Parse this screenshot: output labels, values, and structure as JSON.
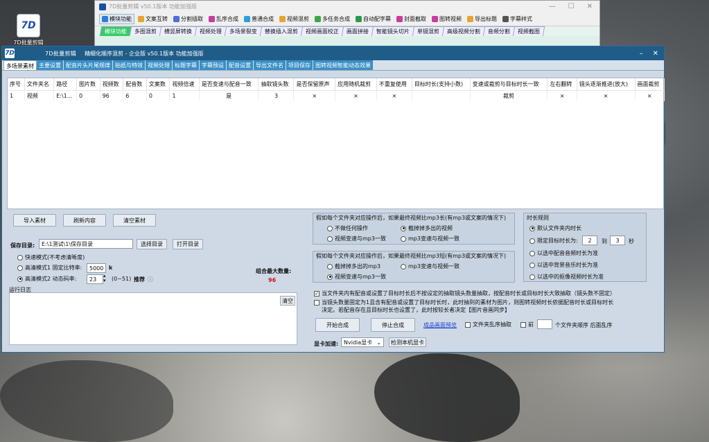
{
  "desktop": {
    "icon_label": "7D批量剪辑"
  },
  "back_window": {
    "title": "7D批量剪辑 v50.1版本 功能加强版",
    "toolbar": [
      {
        "label": "模块功能",
        "color": "#2a7ed8",
        "active": true
      },
      {
        "label": "文案互转",
        "color": "#e7a431"
      },
      {
        "label": "分割插取",
        "color": "#4a6fd8"
      },
      {
        "label": "乱序合成",
        "color": "#c83ca0"
      },
      {
        "label": "普通合成",
        "color": "#2aa0d8"
      },
      {
        "label": "视频混剪",
        "color": "#e7a431"
      },
      {
        "label": "多任务合成",
        "color": "#3aa84a"
      },
      {
        "label": "自动配字幕",
        "color": "#2a9a4a"
      },
      {
        "label": "封面截取",
        "color": "#c83ca0"
      },
      {
        "label": "图转视频",
        "color": "#c83ca0"
      },
      {
        "label": "导出标题",
        "color": "#e7a431"
      },
      {
        "label": "字幕样式",
        "color": "#555555"
      }
    ],
    "subtabs": [
      "模块功能",
      "多图混剪",
      "横竖屏转换",
      "视频处理",
      "多场景裂变",
      "替换插入混剪",
      "视频画面校正",
      "画面拼接",
      "智能镜头切片",
      "单镜混剪",
      "高级视频分割",
      "音频分割",
      "视频截图"
    ]
  },
  "main_window": {
    "title": "7D批量剪辑",
    "subtitle": "精细化顺序混剪 - 企业版  v50.1版本  功能加强版",
    "tabs": [
      "多场景素材",
      "主要设置",
      "配音片头片尾规律",
      "贴纸与特效",
      "视频处理",
      "标题字幕",
      "字幕预设",
      "配音设置",
      "导出文件名",
      "项目保存",
      "图转视频智能动态效果"
    ],
    "table": {
      "headers": [
        "序号",
        "文件夹名",
        "路径",
        "图片数",
        "视频数",
        "配音数",
        "文案数",
        "视频倍速",
        "是否变速与配音一致",
        "抽取镜头数",
        "是否保留原声",
        "应用随机裁剪",
        "不重复使用",
        "目标时长(支持小数)",
        "变速或裁剪与目标时长一致",
        "左右翻转",
        "镜头逐渐推进(放大)",
        "画面裁剪"
      ],
      "rows": [
        [
          "1",
          "视频",
          "E:\\1...",
          "0",
          "96",
          "6",
          "0",
          "1",
          "是",
          "3",
          "×",
          "×",
          "×",
          "",
          "裁剪",
          "×",
          "×",
          "×"
        ]
      ]
    },
    "buttons": {
      "import": "导入素材",
      "refresh": "刷新内容",
      "clear": "清空素材",
      "choose_dir": "选择目录",
      "open_dir": "打开目录",
      "clear_log": "清空",
      "start": "开始合成",
      "stop": "停止合成",
      "detect_gpu": "检测本机显卡"
    },
    "save_dir": {
      "label": "保存目录:",
      "value": "E:\\1测试\\1\\保存目录"
    },
    "modes": {
      "fast": "快速模式(不考虑清晰度)",
      "hq1_label": "高清模式1 固定比特率:",
      "hq1_value": "5000",
      "hq1_unit": "k",
      "hq2_label": "高清模式2 动态码率:",
      "hq2_value": "23",
      "hq2_range": "(0~51)",
      "hq2_recommend": "推荐"
    },
    "combo": {
      "label": "组合最大数量:",
      "value": "96"
    },
    "log_label": "运行日志",
    "group1": {
      "title": "假如每个文件夹对应操作后，如果最终视频比mp3长(有mp3或文案的情况下)",
      "options": [
        "不做任何操作",
        "截掉掉多出的视频",
        "视频变速与mp3一致",
        "mp3变速与视频一致"
      ]
    },
    "group2": {
      "title": "假如每个文件夹对应操作后，如果最终视频比mp3短(有mp3或文案的情况下)",
      "options": [
        "截掉掉多出的mp3",
        "mp3变速与视频一致",
        "视频变速与mp3一致"
      ]
    },
    "group3": {
      "title": "时长规则",
      "options": [
        "默认文件夹内时长",
        "限定目标时长为:",
        "以选中配音音频时长为准",
        "以选中背景音乐时长为准",
        "以选中的抠像视频时长为准"
      ],
      "from": "2",
      "to_label": "到",
      "to": "3",
      "unit": "秒"
    },
    "checks": {
      "c1": "当文件夹内有配音或设置了目标时长后不按设定的抽取镜头数量抽取，按配音时长或目标时长大致抽取（镜头数不固定）",
      "c2_line1": "当镜头数量固定为1且含有配音或设置了目标时长时，此时抽到的素材为图片，则图转视频时长依据配音时长或目标时长",
      "c2_line2": "决定。若配音存在且目标时长也设置了，此时按较长者决定【图片音画同步】",
      "preview_link": "成品画面预览",
      "shuffle": "文件夹乱序抽取",
      "front_label": "前",
      "front_suffix": "个文件夹顺序 后面乱序"
    },
    "gpu": {
      "label": "显卡加速:",
      "value": "Nvidia显卡"
    }
  }
}
